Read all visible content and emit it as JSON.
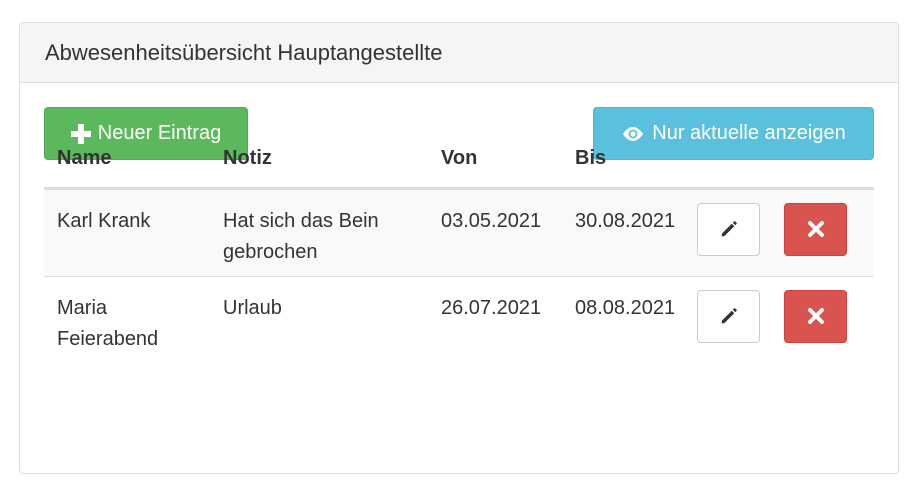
{
  "panel": {
    "title": "Abwesenheitsübersicht Hauptangestellte"
  },
  "toolbar": {
    "new_entry_label": "Neuer Eintrag",
    "new_entry_icon": "plus-icon",
    "show_current_label": "Nur aktuelle anzeigen",
    "show_current_icon": "eye-icon"
  },
  "table": {
    "columns": [
      "Name",
      "Notiz",
      "Von",
      "Bis"
    ],
    "rows": [
      {
        "name": "Karl Krank",
        "notiz": "Hat sich das Bein gebrochen",
        "von": "03.05.2021",
        "bis": "30.08.2021",
        "edit_icon": "pencil-icon",
        "delete_icon": "times-icon"
      },
      {
        "name": "Maria Feierabend",
        "notiz": "Urlaub",
        "von": "26.07.2021",
        "bis": "08.08.2021",
        "edit_icon": "pencil-icon",
        "delete_icon": "times-icon"
      }
    ]
  },
  "colors": {
    "success": "#5cb85c",
    "info": "#5bc0de",
    "danger": "#d9534f",
    "heading_bg": "#f5f5f5"
  }
}
